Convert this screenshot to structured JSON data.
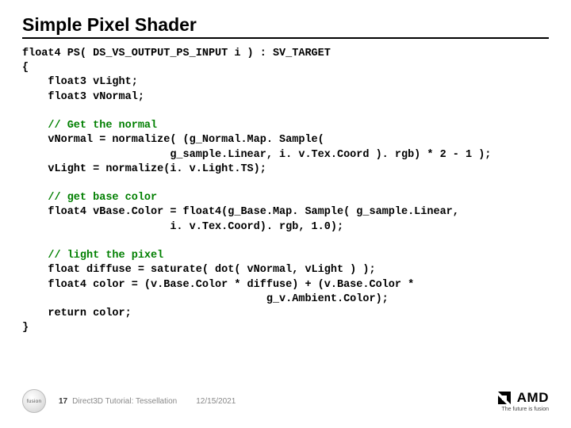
{
  "title": "Simple Pixel Shader",
  "code": {
    "l1": "float4 PS( DS_VS_OUTPUT_PS_INPUT i ) : SV_TARGET",
    "l2": "{",
    "l3": "    float3 vLight;",
    "l4": "    float3 vNormal;",
    "c1": "    // Get the normal",
    "l5": "    vNormal = normalize( (g_Normal.Map. Sample(",
    "l6": "                       g_sample.Linear, i. v.Tex.Coord ). rgb) * 2 - 1 );",
    "l7": "    vLight = normalize(i. v.Light.TS);",
    "c2": "    // get base color",
    "l8": "    float4 vBase.Color = float4(g_Base.Map. Sample( g_sample.Linear,",
    "l9": "                       i. v.Tex.Coord). rgb, 1.0);",
    "c3": "    // light the pixel",
    "l10": "    float diffuse = saturate( dot( vNormal, vLight ) );",
    "l11": "    float4 color = (v.Base.Color * diffuse) + (v.Base.Color *",
    "l12": "                                      g_v.Ambient.Color);",
    "l13": "    return color;",
    "l14": "}"
  },
  "footer": {
    "badge_text": "fusion",
    "page": "17",
    "title": "Direct3D Tutorial: Tessellation",
    "date": "12/15/2021",
    "amd": "AMD",
    "tagline": "The future is fusion"
  }
}
